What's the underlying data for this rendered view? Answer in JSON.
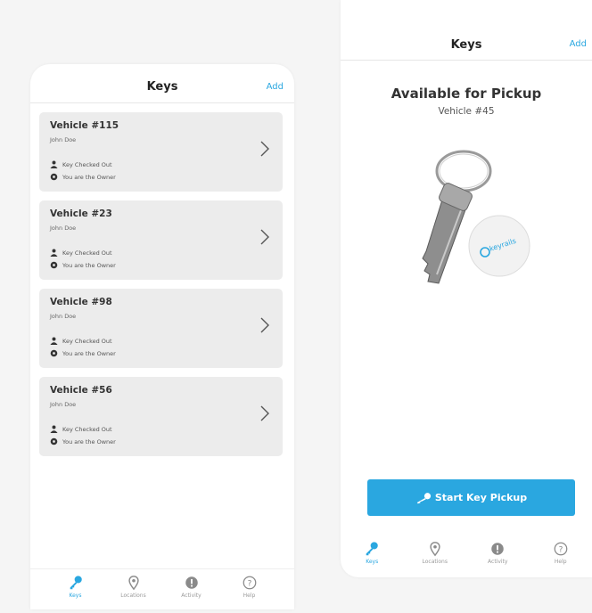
{
  "left_screen": {
    "header": {
      "title": "Keys",
      "add_label": "Add"
    },
    "vehicles": [
      {
        "name": "Vehicle #115",
        "owner": "John Doe",
        "status": "Key Checked Out",
        "role": "You are the Owner"
      },
      {
        "name": "Vehicle #23",
        "owner": "John Doe",
        "status": "Key Checked Out",
        "role": "You are the Owner"
      },
      {
        "name": "Vehicle #98",
        "owner": "John Doe",
        "status": "Key Checked Out",
        "role": "You are the Owner"
      },
      {
        "name": "Vehicle #56",
        "owner": "John Doe",
        "status": "Key Checked Out",
        "role": "You are the Owner"
      }
    ],
    "tabs": [
      {
        "label": "Keys",
        "icon": "key-icon",
        "active": true
      },
      {
        "label": "Locations",
        "icon": "location-pin-icon",
        "active": false
      },
      {
        "label": "Activity",
        "icon": "alert-icon",
        "active": false
      },
      {
        "label": "Help",
        "icon": "help-icon",
        "active": false
      }
    ]
  },
  "right_screen": {
    "header": {
      "title": "Keys",
      "add_label": "Add"
    },
    "pickup_title": "Available for Pickup",
    "vehicle": "Vehicle #45",
    "key_brand": "keyrails",
    "start_button_label": "Start Key Pickup",
    "tabs": [
      {
        "label": "Keys",
        "icon": "key-icon",
        "active": true
      },
      {
        "label": "Locations",
        "icon": "location-pin-icon",
        "active": false
      },
      {
        "label": "Activity",
        "icon": "alert-icon",
        "active": false
      },
      {
        "label": "Help",
        "icon": "help-icon",
        "active": false
      }
    ]
  },
  "colors": {
    "accent": "#2aa7e0",
    "card_bg": "#ececec",
    "inactive_icon": "#8a8a8a"
  }
}
